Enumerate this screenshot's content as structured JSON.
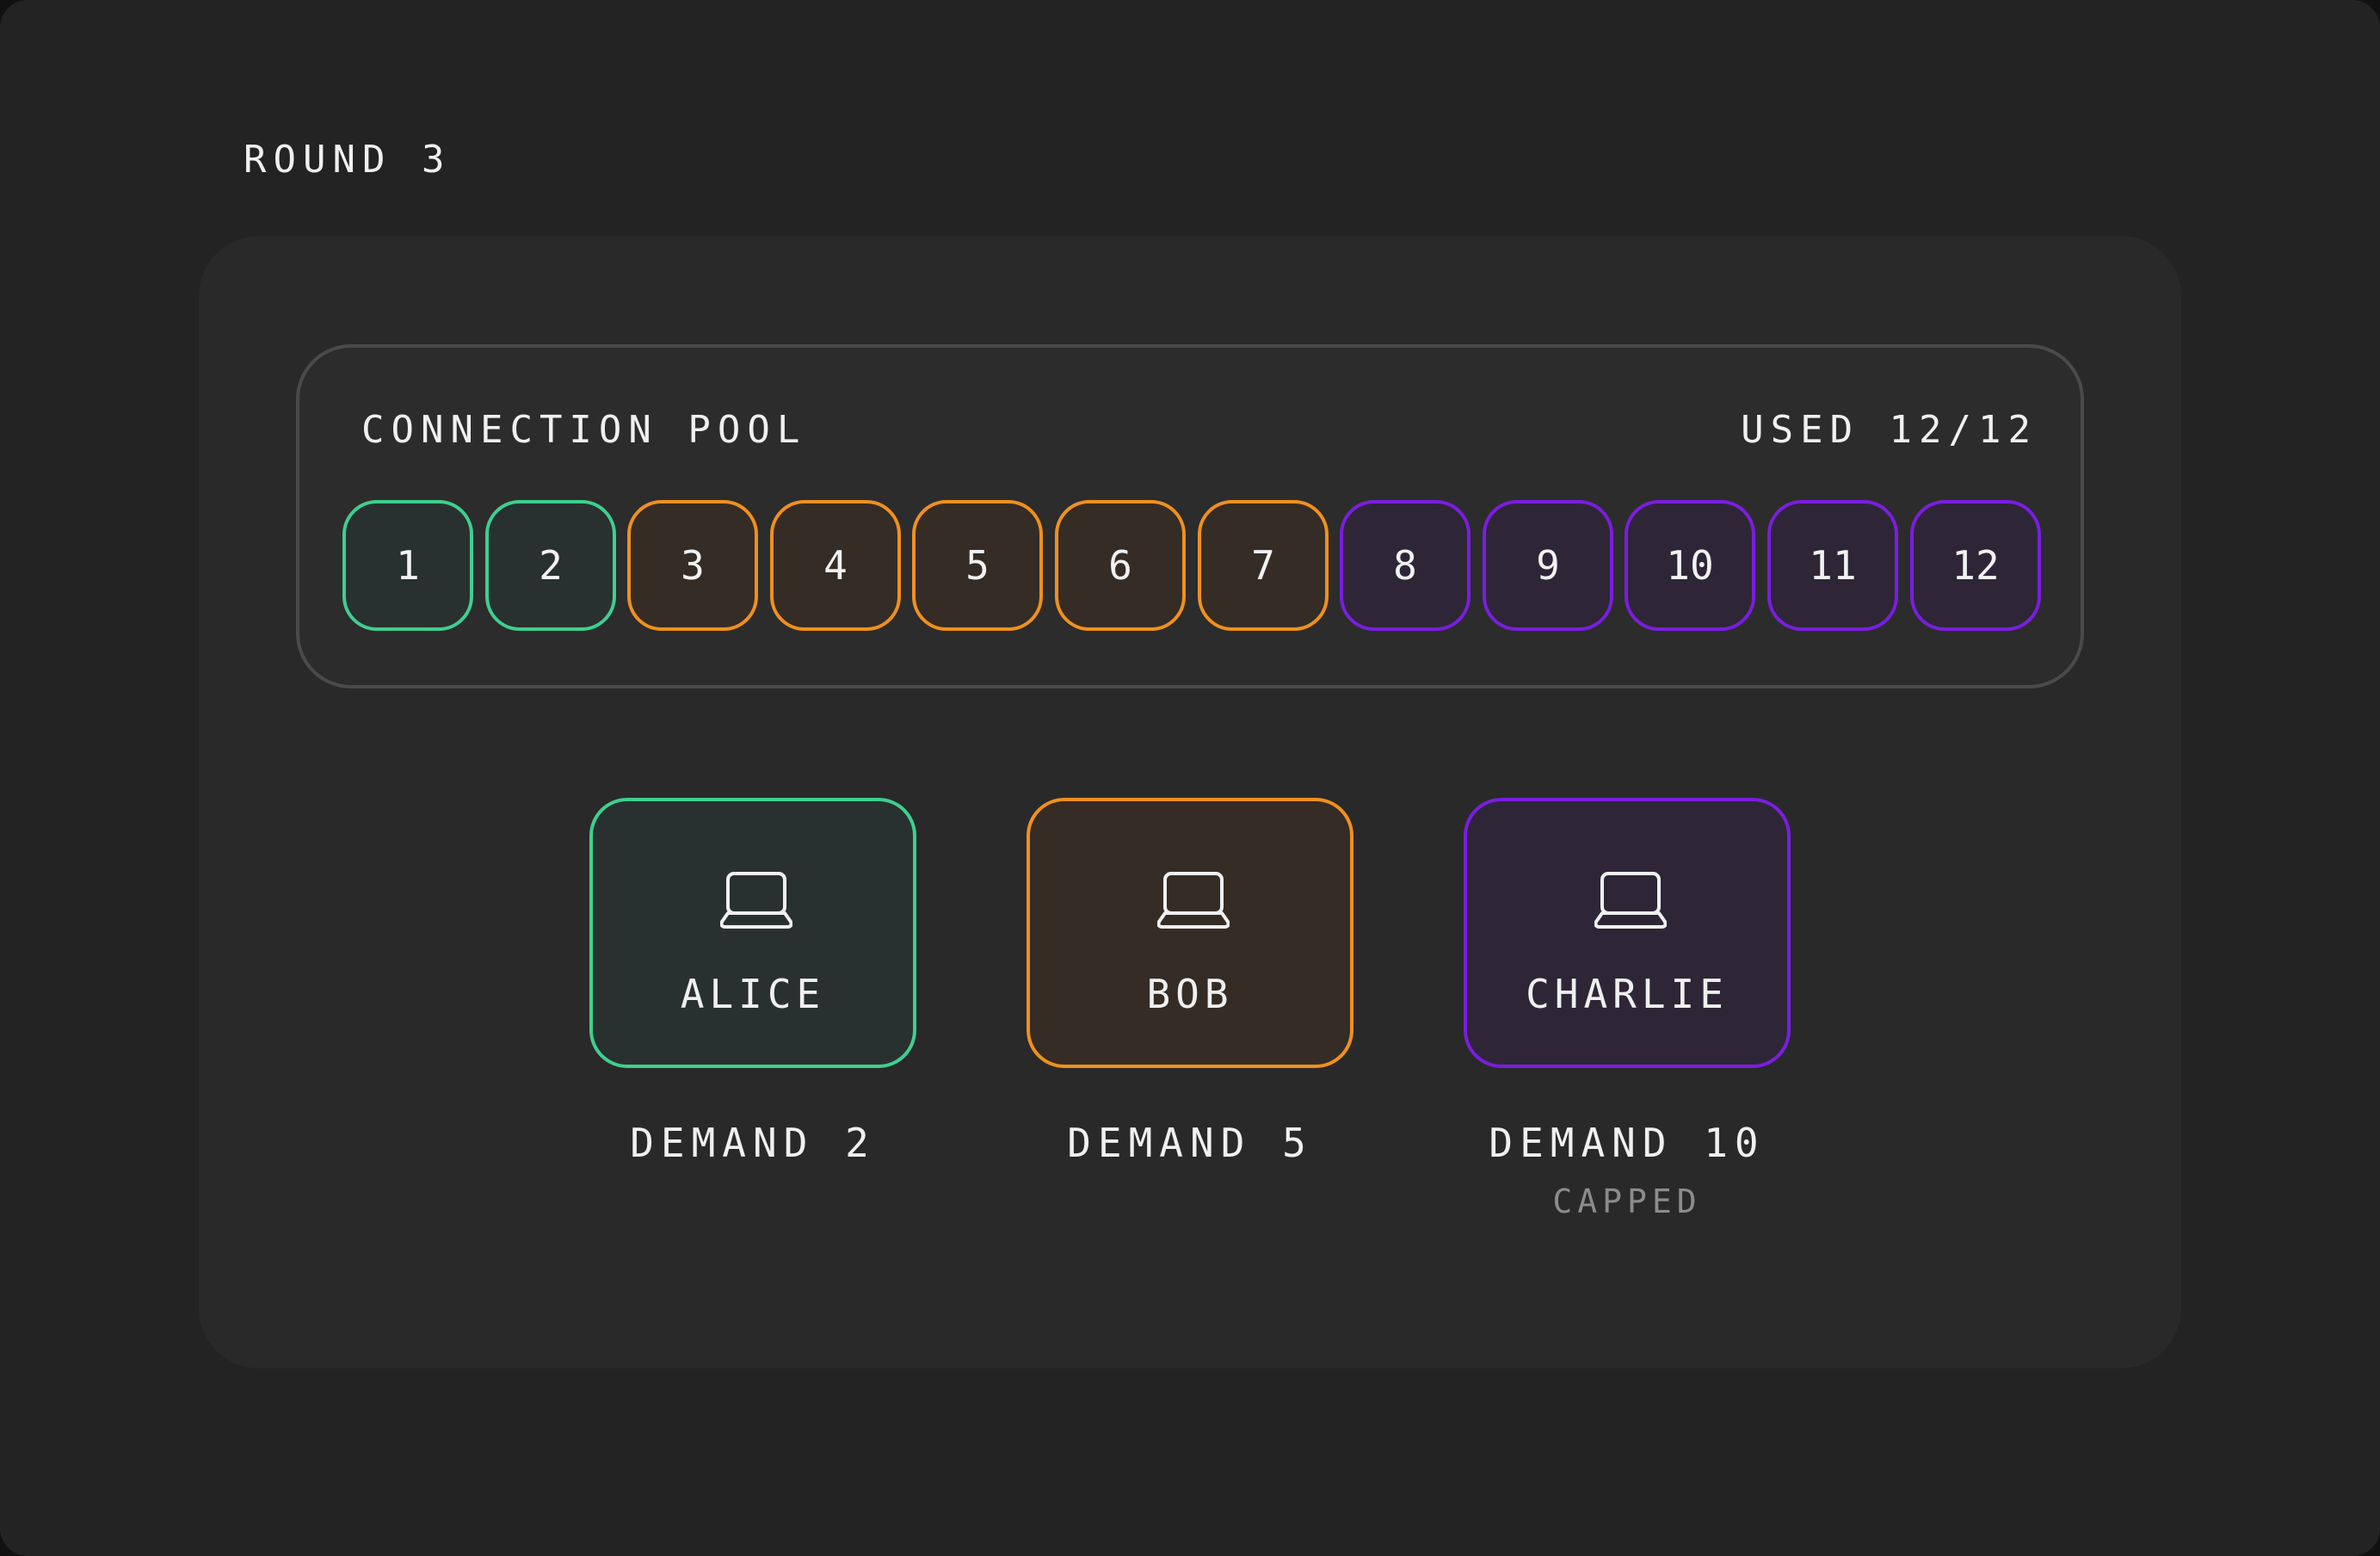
{
  "round_label": "ROUND 3",
  "pool": {
    "title": "CONNECTION POOL",
    "used_label": "USED 12/12"
  },
  "colors": {
    "alice": "#3fcf8e",
    "bob": "#f0901e",
    "charlie": "#7a1ee0",
    "alice_fill": "#293130",
    "bob_fill": "#352c25",
    "charlie_fill": "#2e2636"
  },
  "slots": [
    {
      "label": "1",
      "owner": "alice"
    },
    {
      "label": "2",
      "owner": "alice"
    },
    {
      "label": "3",
      "owner": "bob"
    },
    {
      "label": "4",
      "owner": "bob"
    },
    {
      "label": "5",
      "owner": "bob"
    },
    {
      "label": "6",
      "owner": "bob"
    },
    {
      "label": "7",
      "owner": "bob"
    },
    {
      "label": "8",
      "owner": "charlie"
    },
    {
      "label": "9",
      "owner": "charlie"
    },
    {
      "label": "10",
      "owner": "charlie"
    },
    {
      "label": "11",
      "owner": "charlie"
    },
    {
      "label": "12",
      "owner": "charlie"
    }
  ],
  "clients": [
    {
      "id": "alice",
      "name": "ALICE",
      "icon": "laptop-icon",
      "demand_label": "DEMAND 2",
      "note": ""
    },
    {
      "id": "bob",
      "name": "BOB",
      "icon": "laptop-icon",
      "demand_label": "DEMAND 5",
      "note": ""
    },
    {
      "id": "charlie",
      "name": "CHARLIE",
      "icon": "laptop-icon",
      "demand_label": "DEMAND 10",
      "note": "CAPPED"
    }
  ]
}
